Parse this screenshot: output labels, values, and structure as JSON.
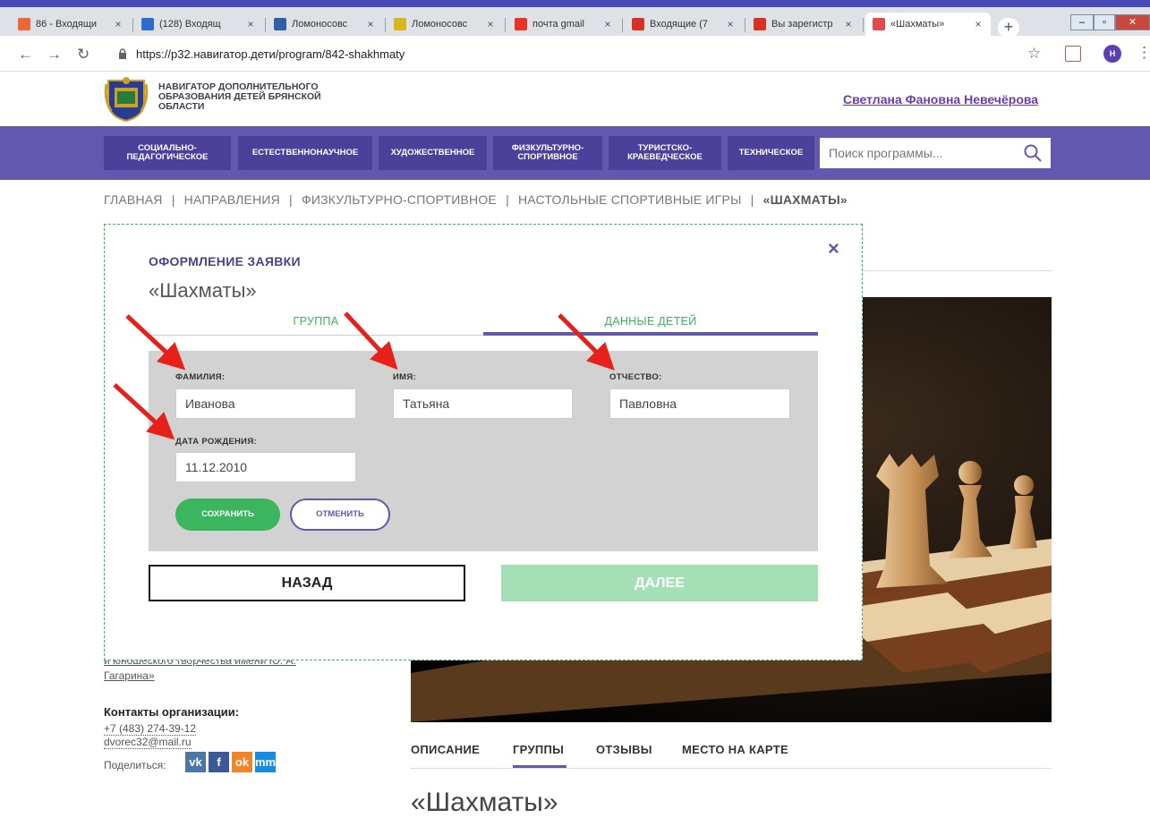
{
  "browser": {
    "tabs": [
      {
        "label": "86 - Входящи",
        "icon_color": "#e8683a",
        "icon": "mail-icon"
      },
      {
        "label": "(128) Входящ",
        "icon_color": "#2c6ccc",
        "icon": "mail-icon"
      },
      {
        "label": "Ломоносовс",
        "icon_color": "#2e5fa7",
        "icon": "site-icon"
      },
      {
        "label": "Ломоносовс",
        "icon_color": "#d6b51d",
        "icon": "site-icon"
      },
      {
        "label": "почта gmail",
        "icon_color": "#e93425",
        "icon": "yandex-icon"
      },
      {
        "label": "Входящие (7",
        "icon_color": "#d93025",
        "icon": "gmail-icon"
      },
      {
        "label": "Вы зарегистр",
        "icon_color": "#d93025",
        "icon": "gmail-icon"
      },
      {
        "label": "«Шахматы»",
        "icon_color": "#e5484d",
        "icon": "navigator-icon"
      }
    ],
    "tab_close_glyph": "×",
    "url": "https://р32.навигатор.дети/program/842-shakhmaty",
    "profile_initial": "Н"
  },
  "site": {
    "logo_line1": "НАВИГАТОР ДОПОЛНИТЕЛЬНОГО",
    "logo_line2": "ОБРАЗОВАНИЯ ДЕТЕЙ БРЯНСКОЙ",
    "logo_line3": "ОБЛАСТИ",
    "user_name": "Светлана Фановна Невечёрова",
    "nav": [
      {
        "l1": "СОЦИАЛЬНО-",
        "l2": "ПЕДАГОГИЧЕСКОЕ"
      },
      {
        "l1": "ЕСТЕСТВЕННОНАУЧНОЕ",
        "l2": ""
      },
      {
        "l1": "ХУДОЖЕСТВЕННОЕ",
        "l2": ""
      },
      {
        "l1": "ФИЗКУЛЬТУРНО-",
        "l2": "СПОРТИВНОЕ"
      },
      {
        "l1": "ТУРИСТСКО-",
        "l2": "КРАЕВЕДЧЕСКОЕ"
      },
      {
        "l1": "ТЕХНИЧЕСКОЕ",
        "l2": ""
      }
    ],
    "search_placeholder": "Поиск программы...",
    "breadcrumb": {
      "home": "ГЛАВНАЯ",
      "sep": "|",
      "directions": "НАПРАВЛЕНИЯ",
      "sport": "ФИЗКУЛЬТУРНО-СПОРТИВНОЕ",
      "boardgames": "НАСТОЛЬНЫЕ СПОРТИВНЫЕ ИГРЫ",
      "current": "«ШАХМАТЫ»"
    }
  },
  "page": {
    "org_link_line1": "и юношеского творчества имени Ю. А.",
    "org_link_line2": "Гагарина»",
    "contacts_title": "Контакты организации:",
    "phone": "+7 (483) 274-39-12",
    "email": "dvorec32@mail.ru",
    "share_label": "Поделиться:",
    "share_buttons": [
      {
        "label": "vk",
        "color": "#4a76a8"
      },
      {
        "label": "f",
        "color": "#3b5998"
      },
      {
        "label": "ok",
        "color": "#f2852a"
      },
      {
        "label": "mm",
        "color": "#168de2"
      }
    ],
    "program_tabs": [
      "ОПИСАНИЕ",
      "ГРУППЫ",
      "ОТЗЫВЫ",
      "МЕСТО НА КАРТЕ"
    ],
    "program_title": "«Шахматы»"
  },
  "modal": {
    "title": "ОФОРМЛЕНИЕ ЗАЯВКИ",
    "subtitle": "«Шахматы»",
    "close_glyph": "×",
    "steps": [
      "ГРУППА",
      "ДАННЫЕ ДЕТЕЙ"
    ],
    "fields": {
      "surname_label": "ФАМИЛИЯ:",
      "surname_value": "Иванова",
      "name_label": "ИМЯ:",
      "name_value": "Татьяна",
      "patronymic_label": "ОТЧЕСТВО:",
      "patronymic_value": "Павловна",
      "birthdate_label": "ДАТА РОЖДЕНИЯ:",
      "birthdate_value": "11.12.2010"
    },
    "save_label": "СОХРАНИТЬ",
    "cancel_label": "ОТМЕНИТЬ",
    "back_label": "НАЗАД",
    "next_label": "ДАЛЕЕ"
  },
  "colors": {
    "brand_purple": "#6358b0",
    "nav_button": "#4b409a",
    "accent_green": "#3bb55e",
    "annotation_red": "#e8201a"
  }
}
